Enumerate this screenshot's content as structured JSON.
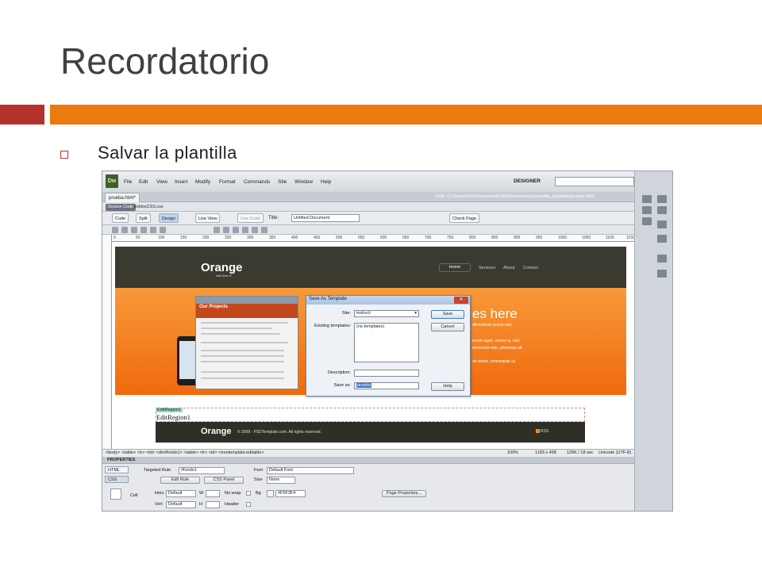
{
  "slide": {
    "title": "Recordatorio",
    "bullet": "Salvar la plantilla"
  },
  "app": {
    "logo": "Dw",
    "menu": [
      "File",
      "Edit",
      "View",
      "Insert",
      "Modify",
      "Format",
      "Commands",
      "Site",
      "Window",
      "Help"
    ],
    "workspace": "DESIGNER",
    "window_controls": [
      "–",
      "□",
      "✕"
    ]
  },
  "document": {
    "tab": "prueba.html*",
    "path": "Path:  C:\\Users\\Fer\\Documents\\ECMH\\instructorias\\plantilla_plantillas\\prueba.html",
    "source_code": "Source Code",
    "css_file": "estilosCSS.css"
  },
  "toolbar": {
    "code": "Code",
    "split": "Split",
    "design": "Design",
    "live_view": "Live View",
    "live_code": "Live Code",
    "title_label": "Title:",
    "title_value": "Untitled Document",
    "check_page": "Check Page"
  },
  "ruler": [
    "0",
    "50",
    "100",
    "150",
    "200",
    "250",
    "300",
    "350",
    "400",
    "450",
    "500",
    "550",
    "600",
    "650",
    "700",
    "750",
    "800",
    "850",
    "900",
    "950",
    "1000",
    "1050",
    "1100",
    "1150"
  ],
  "site": {
    "logo": "Orange",
    "logo_tagline": "well liver it!",
    "nav": [
      "Home",
      "Services",
      "About",
      "Contact"
    ],
    "hero_heading": "es here",
    "hero_lines": [
      "dimentum purus nec",
      "ictum eget, varius a, nisl.",
      "ommodo non, pharetra sit",
      "sit amet, consequat ut."
    ],
    "projects_heading": "Our Projects",
    "edit_region_tag": "EditRegion1",
    "edit_region_text": "EditRegion1",
    "footer_logo": "Orange",
    "footer_copy": "© 2009 - PSDTemplate.com. All rights reserved.",
    "footer_rss": "RSS"
  },
  "dialog": {
    "title": "Save As Template",
    "close": "✕",
    "site_label": "Site:",
    "site_value": "instruct",
    "existing_label": "Existing templates:",
    "existing_value": "(no templates)",
    "description_label": "Description:",
    "description_value": "",
    "save_as_label": "Save as:",
    "save_as_value": "prueba",
    "save_button": "Save",
    "cancel_button": "Cancel",
    "help_button": "Help"
  },
  "status": {
    "tag_path": "<body> <table> <tr> <td> <div#fondo1> <table> <tr> <td> <mmtemplate:editable>",
    "zoom": "100%",
    "size": "1183 x 458",
    "download": "125K / 18 sec",
    "encoding": "Unicode (UTF-8)"
  },
  "properties": {
    "header": "PROPERTIES",
    "html_tab": "HTML",
    "css_tab": "CSS",
    "targeted_rule_label": "Targeted Rule",
    "targeted_rule_value": "#fondo1",
    "edit_rule": "Edit Rule",
    "css_panel": "CSS Panel",
    "font_label": "Font",
    "font_value": "Default Font",
    "size_label": "Size",
    "size_value": "None",
    "cell_label": "Cell",
    "horz_label": "Horz",
    "horz_value": "Default",
    "vert_label": "Vert",
    "vert_value": "Default",
    "w_label": "W",
    "h_label": "H",
    "nowrap_label": "No wrap",
    "header_label": "Header",
    "bg_label": "Bg",
    "bg_value": "#F5F3F4",
    "page_properties": "Page Properties..."
  }
}
